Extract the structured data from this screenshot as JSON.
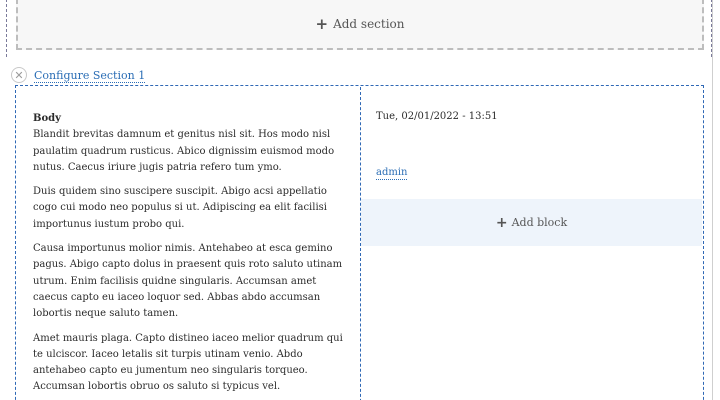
{
  "add_section": {
    "icon": "plus-icon",
    "label": "Add section"
  },
  "section_controls": {
    "close_icon": "close-icon",
    "close_glyph": "✕",
    "configure_label": "Configure Section 1"
  },
  "body_field": {
    "label": "Body",
    "paragraphs": [
      "Blandit brevitas damnum et genitus nisl sit. Hos modo nisl paulatim quadrum rusticus. Abico dignissim euismod modo nutus. Caecus iriure jugis patria refero tum ymo.",
      "Duis quidem sino suscipere suscipit. Abigo acsi appellatio cogo cui modo neo populus si ut. Adipiscing ea elit facilisi importunus iustum probo qui.",
      "Causa importunus molior nimis. Antehabeo at esca gemino pagus. Abigo capto dolus in praesent quis roto saluto utinam utrum. Enim facilisis quidne singularis. Accumsan amet caecus capto eu iaceo loquor sed. Abbas abdo accumsan lobortis neque saluto tamen.",
      "Amet mauris plaga. Capto distineo iaceo melior quadrum qui te ulciscor. Iaceo letalis sit turpis utinam venio. Abdo antehabeo capto eu jumentum neo singularis torqueo. Accumsan lobortis obruo os saluto si typicus vel."
    ]
  },
  "meta": {
    "date": "Tue, 02/01/2022 - 13:51",
    "author": "admin"
  },
  "add_block": {
    "icon": "plus-icon",
    "label": "Add block"
  },
  "colors": {
    "link": "#2a6db5",
    "outline": "#2f68b5",
    "add_block_bg": "#eef4fb",
    "add_section_bg": "#f7f7f7"
  }
}
